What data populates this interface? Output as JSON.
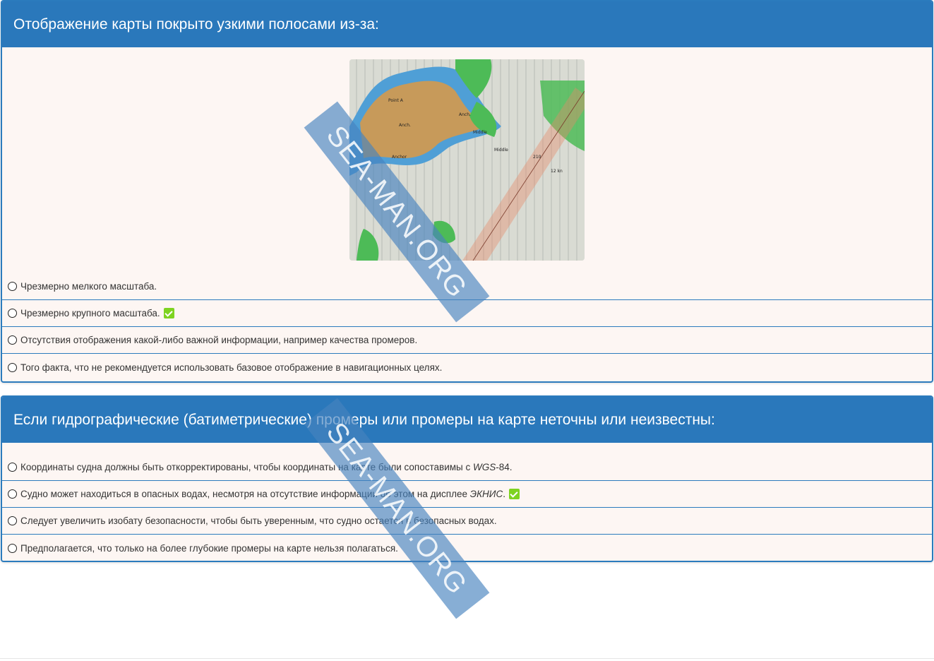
{
  "question1": {
    "title": "Отображение карты покрыто узкими полосами из-за:",
    "options": [
      {
        "text": "Чрезмерно мелкого масштаба.",
        "correct": false
      },
      {
        "text": "Чрезмерно крупного масштаба.",
        "correct": true
      },
      {
        "text": "Отсутствия отображения какой-либо важной информации, например качества промеров.",
        "correct": false
      },
      {
        "text": "Того факта, что не рекомендуется использовать базовое отображение в навигационных целях.",
        "correct": false
      }
    ]
  },
  "question2": {
    "title": "Если гидрографические (батиметрические) промеры или промеры на карте неточны или неизвестны:",
    "options": [
      {
        "prefix": "Координаты судна должны быть откорректированы, чтобы координаты на карте были сопоставимы с ",
        "italic": "WGS",
        "suffix": "-84.",
        "correct": false
      },
      {
        "prefix": "Судно может находиться в опасных водах, несмотря на отсутствие информации об этом на дисплее ",
        "italic": "ЭКНИС",
        "suffix": ".",
        "correct": true
      },
      {
        "text": "Следует увеличить изобату безопасности, чтобы быть уверенным, что судно остается в безопасных водах.",
        "correct": false
      },
      {
        "text": "Предполагается, что только на более глубокие промеры на карте нельзя полагаться.",
        "correct": false
      }
    ]
  },
  "watermark": "SEA-MAN.ORG",
  "colors": {
    "header": "#2a78bb",
    "border": "#2b7bbd",
    "card_bg": "#fdf6f3",
    "check": "#7ed321"
  },
  "icons": [
    "radio-icon",
    "check-icon"
  ]
}
